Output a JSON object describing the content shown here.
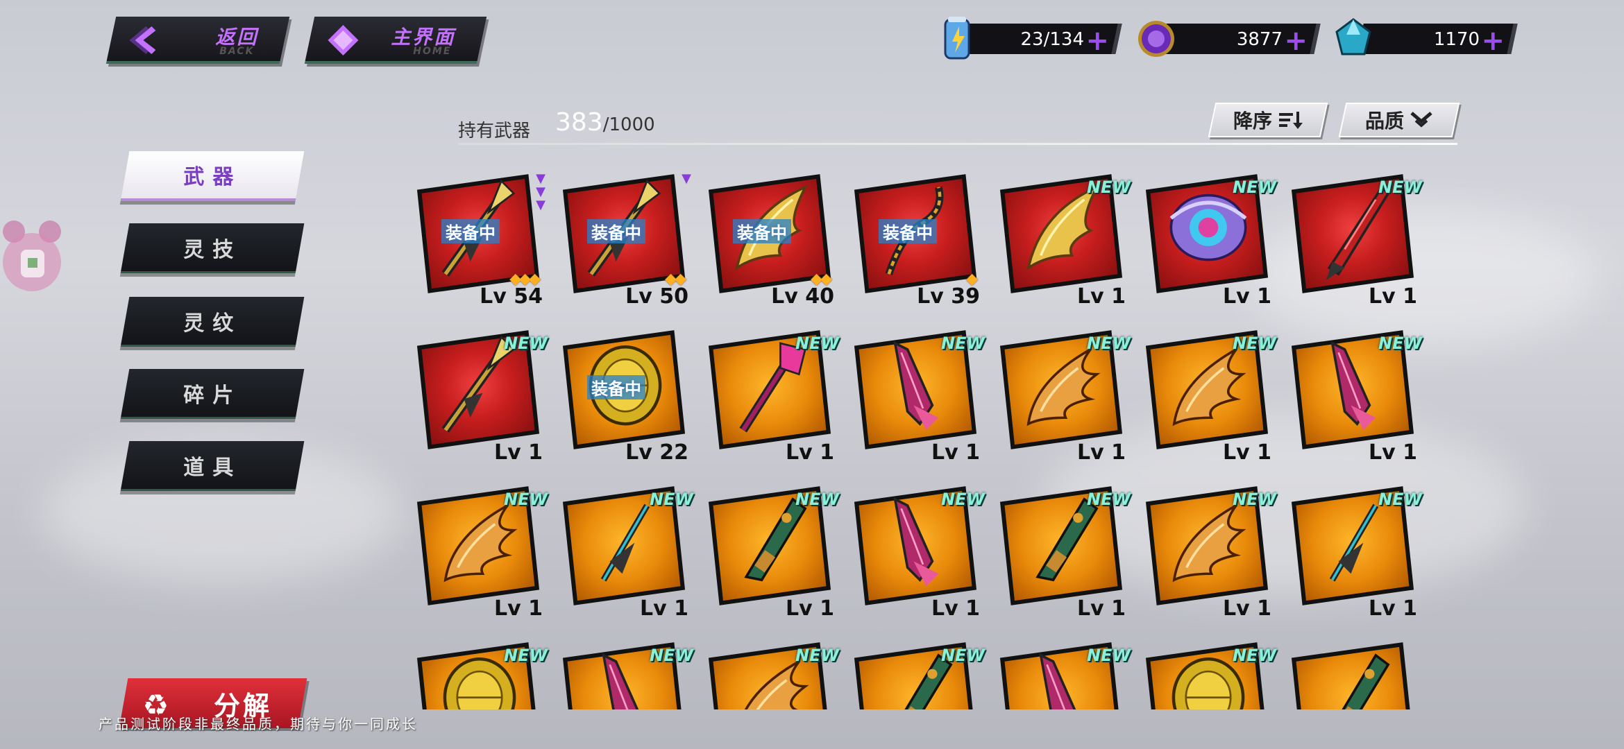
{
  "nav": {
    "back": {
      "zh": "返回",
      "en": "BACK"
    },
    "home": {
      "zh": "主界面",
      "en": "HOME"
    }
  },
  "resources": [
    {
      "name": "stamina",
      "icon": "energy-can-icon",
      "value": "23/134"
    },
    {
      "name": "coin",
      "icon": "purple-coin-icon",
      "value": "3877"
    },
    {
      "name": "crystal",
      "icon": "blue-crystal-icon",
      "value": "1170"
    }
  ],
  "header": {
    "label": "持有武器",
    "count": "383",
    "total": "/1000"
  },
  "sort": {
    "order_label": "降序",
    "quality_label": "品质"
  },
  "tabs": [
    "武器",
    "灵技",
    "灵纹",
    "碎片",
    "道具"
  ],
  "active_tab": 0,
  "weapons": [
    {
      "lv": "Lv 54",
      "bg": "red",
      "equipped": "装备中",
      "new": "",
      "stars": 3,
      "tri": 3,
      "kind": "spear"
    },
    {
      "lv": "Lv 50",
      "bg": "red",
      "equipped": "装备中",
      "new": "",
      "stars": 2,
      "tri": 1,
      "kind": "spear"
    },
    {
      "lv": "Lv 40",
      "bg": "red",
      "equipped": "装备中",
      "new": "",
      "stars": 2,
      "tri": 0,
      "kind": "wing"
    },
    {
      "lv": "Lv 39",
      "bg": "red",
      "equipped": "装备中",
      "new": "",
      "stars": 1,
      "tri": 0,
      "kind": "chain"
    },
    {
      "lv": "Lv 1",
      "bg": "red",
      "equipped": "",
      "new": "NEW",
      "stars": 0,
      "tri": 0,
      "kind": "wing"
    },
    {
      "lv": "Lv 1",
      "bg": "red",
      "equipped": "",
      "new": "NEW",
      "stars": 0,
      "tri": 0,
      "kind": "orb"
    },
    {
      "lv": "Lv 1",
      "bg": "red",
      "equipped": "",
      "new": "NEW",
      "stars": 0,
      "tri": 0,
      "kind": "blade"
    },
    {
      "lv": "Lv 1",
      "bg": "red",
      "equipped": "",
      "new": "NEW",
      "stars": 0,
      "tri": 0,
      "kind": "spear"
    },
    {
      "lv": "Lv 22",
      "bg": "gold",
      "equipped": "装备中",
      "new": "",
      "stars": 0,
      "tri": 0,
      "kind": "shield"
    },
    {
      "lv": "Lv 1",
      "bg": "gold",
      "equipped": "",
      "new": "NEW",
      "stars": 0,
      "tri": 0,
      "kind": "staff"
    },
    {
      "lv": "Lv 1",
      "bg": "gold",
      "equipped": "",
      "new": "NEW",
      "stars": 0,
      "tri": 0,
      "kind": "dagger"
    },
    {
      "lv": "Lv 1",
      "bg": "gold",
      "equipped": "",
      "new": "NEW",
      "stars": 0,
      "tri": 0,
      "kind": "claw"
    },
    {
      "lv": "Lv 1",
      "bg": "gold",
      "equipped": "",
      "new": "NEW",
      "stars": 0,
      "tri": 0,
      "kind": "claw"
    },
    {
      "lv": "Lv 1",
      "bg": "gold",
      "equipped": "",
      "new": "NEW",
      "stars": 0,
      "tri": 0,
      "kind": "dagger"
    },
    {
      "lv": "Lv 1",
      "bg": "gold",
      "equipped": "",
      "new": "NEW",
      "stars": 0,
      "tri": 0,
      "kind": "claw"
    },
    {
      "lv": "Lv 1",
      "bg": "gold",
      "equipped": "",
      "new": "NEW",
      "stars": 0,
      "tri": 0,
      "kind": "spike"
    },
    {
      "lv": "Lv 1",
      "bg": "gold",
      "equipped": "",
      "new": "NEW",
      "stars": 0,
      "tri": 0,
      "kind": "gun"
    },
    {
      "lv": "Lv 1",
      "bg": "gold",
      "equipped": "",
      "new": "NEW",
      "stars": 0,
      "tri": 0,
      "kind": "dagger"
    },
    {
      "lv": "Lv 1",
      "bg": "gold",
      "equipped": "",
      "new": "NEW",
      "stars": 0,
      "tri": 0,
      "kind": "gun"
    },
    {
      "lv": "Lv 1",
      "bg": "gold",
      "equipped": "",
      "new": "NEW",
      "stars": 0,
      "tri": 0,
      "kind": "claw"
    },
    {
      "lv": "Lv 1",
      "bg": "gold",
      "equipped": "",
      "new": "NEW",
      "stars": 0,
      "tri": 0,
      "kind": "spike"
    },
    {
      "lv": "",
      "bg": "gold",
      "equipped": "",
      "new": "NEW",
      "stars": 0,
      "tri": 0,
      "kind": "shield"
    },
    {
      "lv": "",
      "bg": "gold",
      "equipped": "",
      "new": "NEW",
      "stars": 0,
      "tri": 0,
      "kind": "dagger"
    },
    {
      "lv": "",
      "bg": "gold",
      "equipped": "",
      "new": "NEW",
      "stars": 0,
      "tri": 0,
      "kind": "claw"
    },
    {
      "lv": "",
      "bg": "gold",
      "equipped": "",
      "new": "NEW",
      "stars": 0,
      "tri": 0,
      "kind": "gun"
    },
    {
      "lv": "",
      "bg": "gold",
      "equipped": "",
      "new": "NEW",
      "stars": 0,
      "tri": 0,
      "kind": "dagger"
    },
    {
      "lv": "",
      "bg": "gold",
      "equipped": "",
      "new": "NEW",
      "stars": 0,
      "tri": 0,
      "kind": "shield"
    },
    {
      "lv": "",
      "bg": "gold",
      "equipped": "",
      "new": "",
      "stars": 0,
      "tri": 0,
      "kind": "gun"
    }
  ],
  "decompose": {
    "label": "分解",
    "icon": "recycle-icon"
  },
  "disclaimer": "产品测试阶段非最终品质，期待与你一同成长",
  "colors": {
    "accent": "#9b4cf0",
    "red_card": "#c81e1e",
    "gold_card": "#e8890a",
    "new_tag": "#8af0d8"
  }
}
